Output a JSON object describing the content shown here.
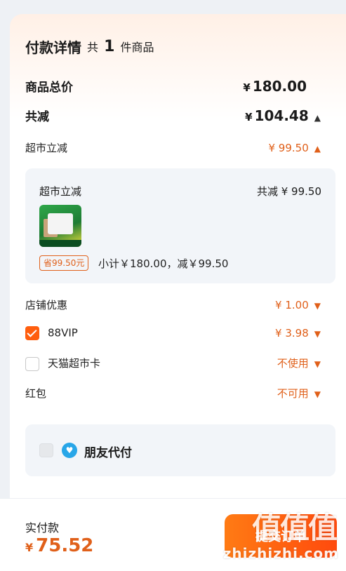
{
  "header": {
    "title": "付款详情",
    "count_prefix": "共",
    "count": "1",
    "count_suffix": "件商品"
  },
  "total_goods": {
    "label": "商品总价",
    "currency": "¥",
    "amount": "180.00"
  },
  "total_discount": {
    "label": "共减",
    "currency": "¥",
    "amount": "104.48"
  },
  "supermarket_discount": {
    "label": "超市立减",
    "value": "¥ 99.50"
  },
  "discount_detail": {
    "title": "超市立减",
    "total_text": "共减 ¥ 99.50",
    "save_tag": "省99.50元",
    "subtotal_text": "小计￥180.00，减￥99.50"
  },
  "store_offer": {
    "label": "店铺优惠",
    "value": "¥ 1.00"
  },
  "vip": {
    "label": "88VIP",
    "value": "¥ 3.98",
    "checked": true
  },
  "tmall_card": {
    "label": "天猫超市卡",
    "value": "不使用",
    "checked": false
  },
  "red_packet": {
    "label": "红包",
    "value": "不可用"
  },
  "friend_pay": {
    "label": "朋友代付",
    "checked": false
  },
  "footer": {
    "pay_label": "实付款",
    "currency": "¥",
    "pay_amount": "75.52",
    "submit_label": "提交订单"
  },
  "watermark": {
    "text": "zhizhizhi.com",
    "mark": "值值值"
  },
  "colors": {
    "accent": "#e0601a",
    "button_start": "#ff7b14",
    "button_end": "#ff4a0d"
  }
}
